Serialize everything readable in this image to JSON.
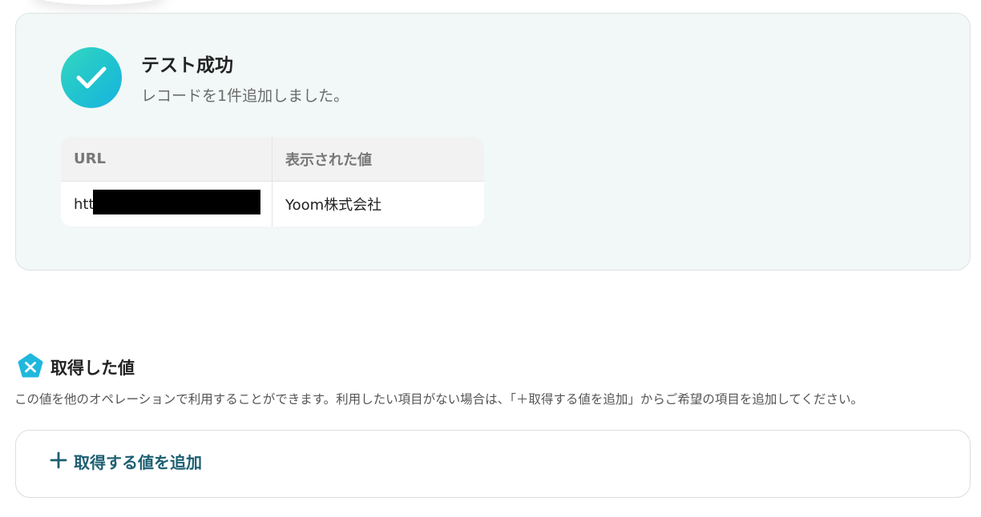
{
  "result": {
    "title": "テスト成功",
    "subtitle": "レコードを1件追加しました。"
  },
  "table": {
    "headers": [
      "URL",
      "表示された値"
    ],
    "rows": [
      {
        "url": "htt",
        "value": "Yoom株式会社"
      }
    ]
  },
  "captured": {
    "title": "取得した値",
    "description": "この値を他のオペレーションで利用することができます。利用したい項目がない場合は、「＋取得する値を追加」からご希望の項目を追加してください。",
    "add_label": "取得する値を追加"
  },
  "colors": {
    "success_gradient": [
      "#36d6c0",
      "#1ab3e0"
    ],
    "card_background": "#f1f8f7",
    "accent_text": "#1d5f72",
    "section_icon": "#1fb8dc"
  },
  "icons": {
    "success": "check-icon",
    "section": "yoom-pentagon-icon",
    "add": "plus-icon"
  }
}
